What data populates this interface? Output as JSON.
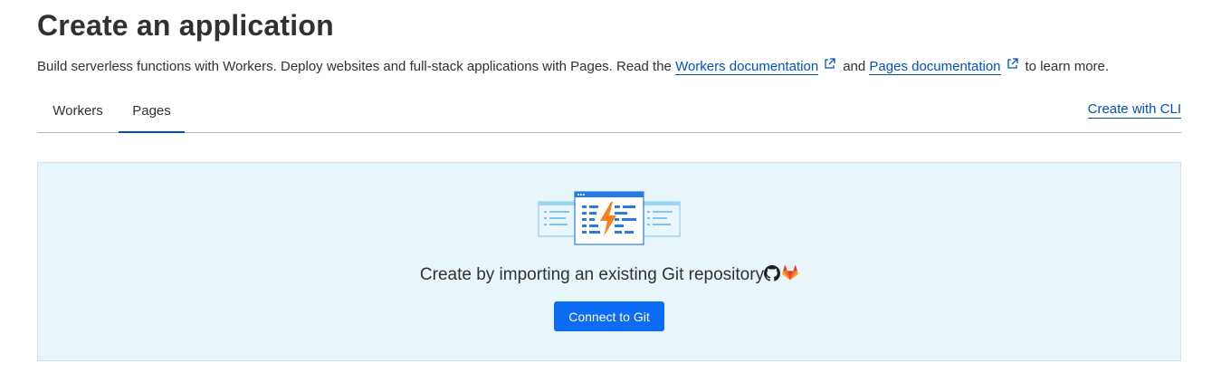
{
  "header": {
    "title": "Create an application",
    "description_prefix": "Build serverless functions with Workers. Deploy websites and full-stack applications with Pages. Read the",
    "workers_docs_link": "Workers documentation",
    "and_text": "and",
    "pages_docs_link": "Pages documentation",
    "description_suffix": "to learn more."
  },
  "tabs": [
    {
      "label": "Workers",
      "active": false
    },
    {
      "label": "Pages",
      "active": true
    }
  ],
  "create_cli_link": "Create with CLI",
  "panel": {
    "prompt": "Create by importing an existing Git repository",
    "icons": [
      "github-icon",
      "gitlab-icon"
    ],
    "connect_button": "Connect to Git"
  },
  "colors": {
    "link": "#0051c3",
    "primary_button": "#0c6cf5",
    "panel_background": "#e8f5fa",
    "lightning": "#f6821f"
  }
}
